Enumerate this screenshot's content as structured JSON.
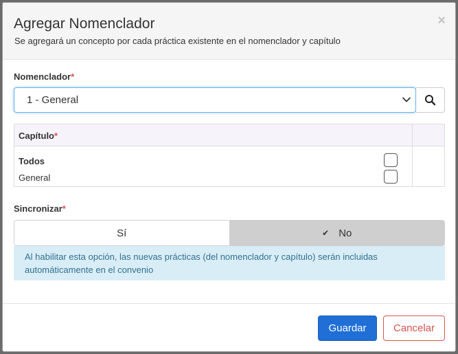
{
  "modal": {
    "title": "Agregar Nomenclador",
    "subtitle": "Se agregará un concepto por cada práctica existente en el nomenclador y capítulo",
    "close_symbol": "×"
  },
  "nomenclador": {
    "label": "Nomenclador",
    "required_mark": "*",
    "selected_value": "1 - General"
  },
  "capitulo": {
    "label": "Capítulo",
    "required_mark": "*",
    "rows": [
      {
        "label": "Todos",
        "checked": false
      },
      {
        "label": "General",
        "checked": false
      }
    ]
  },
  "sincronizar": {
    "label": "Sincronizar",
    "required_mark": "*",
    "option_yes": "Sí",
    "option_no": "No",
    "check_symbol": "✔",
    "selected": "No",
    "info": "Al habilitar esta opción, las nuevas prácticas (del nomenclador y capítulo) serán incluidas automáticamente en el convenio"
  },
  "footer": {
    "save_label": "Guardar",
    "cancel_label": "Cancelar"
  },
  "colors": {
    "primary": "#1f6fd6",
    "danger": "#d9534f",
    "info_bg": "#d9edf7",
    "info_text": "#31708f"
  }
}
